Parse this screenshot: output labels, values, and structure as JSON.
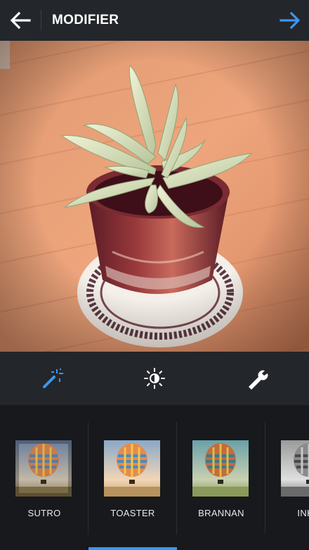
{
  "header": {
    "title": "MODIFIER",
    "back_icon": "arrow-left-icon",
    "next_icon": "arrow-right-icon",
    "accent_color": "#3897f0"
  },
  "photo": {
    "subject": "succulent-plant-in-pot"
  },
  "toolbar": {
    "tools": [
      {
        "icon": "magic-wand-icon",
        "selected": true
      },
      {
        "icon": "brightness-icon",
        "selected": false
      },
      {
        "icon": "wrench-icon",
        "selected": false
      }
    ]
  },
  "filters": [
    {
      "label": "SUTRO",
      "selected": false
    },
    {
      "label": "TOASTER",
      "selected": true
    },
    {
      "label": "BRANNAN",
      "selected": false
    },
    {
      "label": "INKW",
      "selected": false
    }
  ]
}
